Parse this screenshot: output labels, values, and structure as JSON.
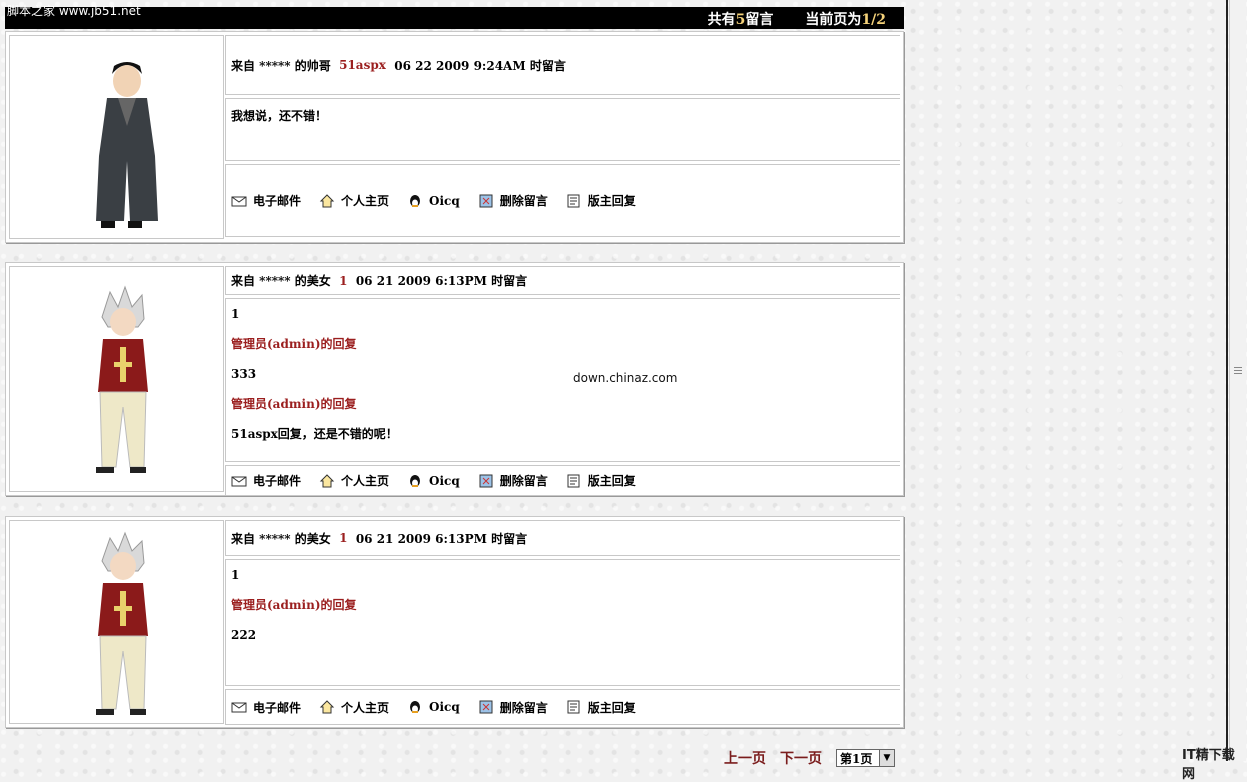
{
  "site_logo": "脚本之家 www.jb51.net",
  "topbar": {
    "total_prefix": "共有",
    "total_count": "5",
    "total_suffix": "留言",
    "page_prefix": "当前页为",
    "page_value": "1/2"
  },
  "actions": [
    "电子邮件",
    "个人主页",
    "Oicq",
    "删除留言",
    "版主回复"
  ],
  "icons": [
    "email-icon",
    "home-icon",
    "qq-penguin-icon",
    "delete-icon",
    "reply-icon"
  ],
  "posts": [
    {
      "from": "来自 ***** 的帅哥",
      "name": "51aspx",
      "time": "06 22 2009 9:24AM 时留言",
      "body": [
        {
          "text": "我想说，还不错！",
          "type": "normal"
        }
      ]
    },
    {
      "from": "来自 ***** 的美女",
      "name": "1",
      "time": "06 21 2009 6:13PM 时留言",
      "body": [
        {
          "text": "1",
          "type": "normal"
        },
        {
          "text": "管理员(admin)的回复",
          "type": "admin"
        },
        {
          "text": "333",
          "type": "normal"
        },
        {
          "text": "管理员(admin)的回复",
          "type": "admin"
        },
        {
          "text": "51aspx回复，还是不错的呢！",
          "type": "normal"
        }
      ]
    },
    {
      "from": "来自 ***** 的美女",
      "name": "1",
      "time": "06 21 2009 6:13PM 时留言",
      "body": [
        {
          "text": "1",
          "type": "normal"
        },
        {
          "text": "管理员(admin)的回复",
          "type": "admin"
        },
        {
          "text": "222",
          "type": "normal"
        }
      ]
    }
  ],
  "watermark": "down.chinaz.com",
  "pager": {
    "prev": "上一页",
    "next": "下一页",
    "page_select": "第1页"
  },
  "corner_logo": "IT精下载网"
}
